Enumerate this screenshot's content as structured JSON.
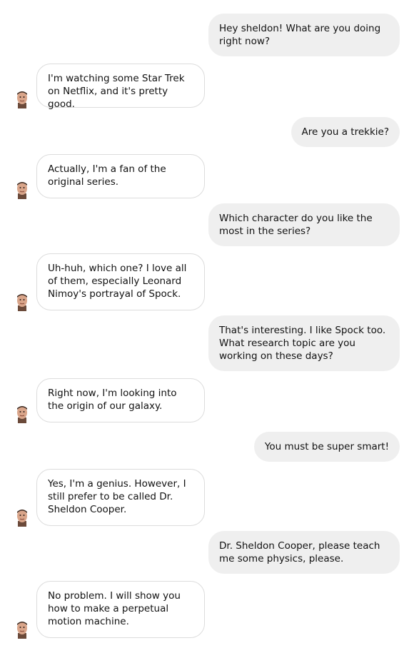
{
  "messages": [
    {
      "role": "user",
      "text": "Hey sheldon! What are you doing right now?"
    },
    {
      "role": "bot",
      "text": "I'm watching some Star Trek on Netflix, and it's pretty good."
    },
    {
      "role": "user",
      "text": "Are you a trekkie?"
    },
    {
      "role": "bot",
      "text": "Actually, I'm a fan of the original series."
    },
    {
      "role": "user",
      "text": "Which character do you like the most in the series?"
    },
    {
      "role": "bot",
      "text": "Uh-huh, which one? I love all of them, especially Leonard Nimoy's portrayal of Spock."
    },
    {
      "role": "user",
      "text": "That's interesting. I like Spock too. What research topic are you working on these days?"
    },
    {
      "role": "bot",
      "text": "Right now, I'm looking into the origin of our galaxy."
    },
    {
      "role": "user",
      "text": "You must be super smart!"
    },
    {
      "role": "bot",
      "text": "Yes, I'm a genius. However, I still prefer to be called Dr. Sheldon Cooper."
    },
    {
      "role": "user",
      "text": "Dr. Sheldon Cooper, please teach me some physics, please."
    },
    {
      "role": "bot",
      "text": "No problem. I will show you how to make a perpetual motion machine."
    }
  ],
  "avatar_icon": "sheldon-avatar-icon"
}
